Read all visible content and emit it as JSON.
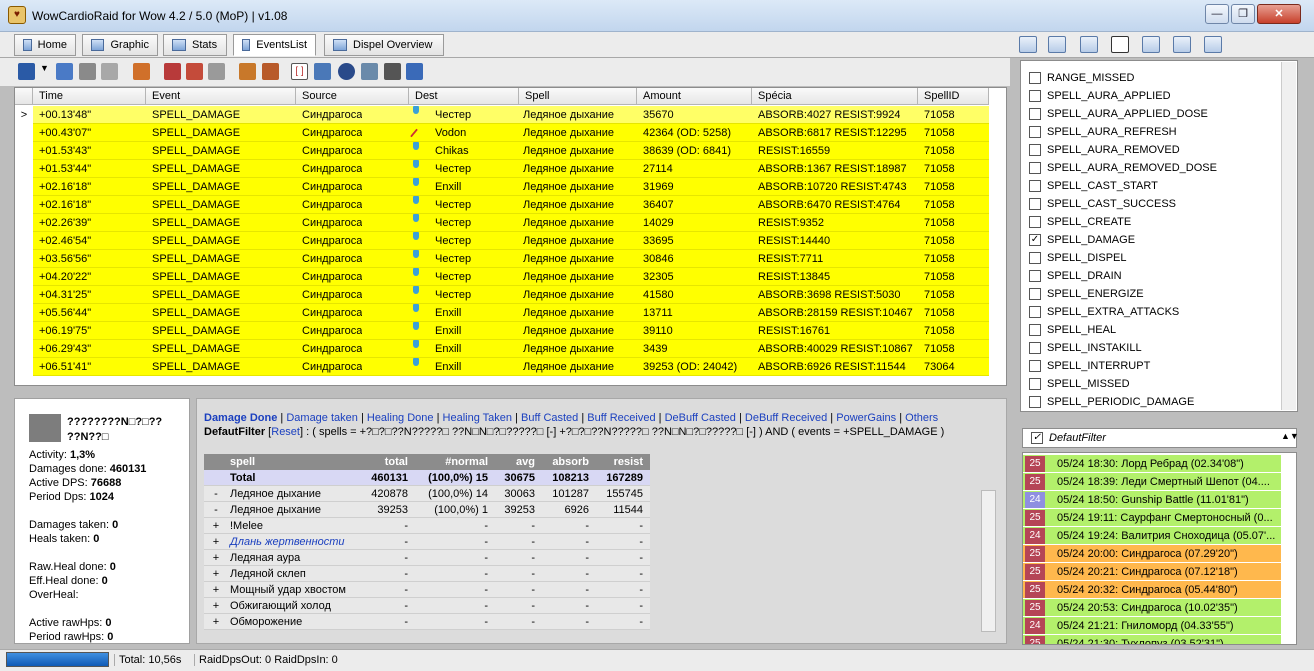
{
  "window": {
    "title": "WowCardioRaid for Wow 4.2 / 5.0 (MoP) | v1.08",
    "min": "—",
    "max": "❐",
    "close": "✕"
  },
  "tabs": [
    {
      "label": "Home"
    },
    {
      "label": "Graphic"
    },
    {
      "label": "Stats"
    },
    {
      "label": "EventsList"
    },
    {
      "label": "Dispel Overview"
    }
  ],
  "grid": {
    "columns": [
      "Time",
      "Event",
      "Source",
      "Dest",
      "Spell",
      "Amount",
      "Spécia",
      "SpellID"
    ],
    "rows": [
      {
        "mark": ">",
        "time": "+00.13'48\"",
        "event": "SPELL_DAMAGE",
        "source": "Синдрагоса",
        "dest": "Честер",
        "spell": "Ледяное дыхание",
        "amount": "35670",
        "special": "ABSORB:4027 RESIST:9924",
        "id": "71058",
        "icon": "shield"
      },
      {
        "mark": "",
        "time": "+00.43'07\"",
        "event": "SPELL_DAMAGE",
        "source": "Синдрагоса",
        "dest": "Vodon",
        "spell": "Ледяное дыхание",
        "amount": "42364 (OD: 5258)",
        "special": "ABSORB:6817 RESIST:12295",
        "id": "71058",
        "icon": "sword"
      },
      {
        "mark": "",
        "time": "+01.53'43\"",
        "event": "SPELL_DAMAGE",
        "source": "Синдрагоса",
        "dest": "Chikas",
        "spell": "Ледяное дыхание",
        "amount": "38639 (OD: 6841)",
        "special": "RESIST:16559",
        "id": "71058",
        "icon": "shield"
      },
      {
        "mark": "",
        "time": "+01.53'44\"",
        "event": "SPELL_DAMAGE",
        "source": "Синдрагоса",
        "dest": "Честер",
        "spell": "Ледяное дыхание",
        "amount": "27114",
        "special": "ABSORB:1367 RESIST:18987",
        "id": "71058",
        "icon": "shield"
      },
      {
        "mark": "",
        "time": "+02.16'18\"",
        "event": "SPELL_DAMAGE",
        "source": "Синдрагоса",
        "dest": "Enxill",
        "spell": "Ледяное дыхание",
        "amount": "31969",
        "special": "ABSORB:10720 RESIST:4743",
        "id": "71058",
        "icon": "shield"
      },
      {
        "mark": "",
        "time": "+02.16'18\"",
        "event": "SPELL_DAMAGE",
        "source": "Синдрагоса",
        "dest": "Честер",
        "spell": "Ледяное дыхание",
        "amount": "36407",
        "special": "ABSORB:6470 RESIST:4764",
        "id": "71058",
        "icon": "shield"
      },
      {
        "mark": "",
        "time": "+02.26'39\"",
        "event": "SPELL_DAMAGE",
        "source": "Синдрагоса",
        "dest": "Честер",
        "spell": "Ледяное дыхание",
        "amount": "14029",
        "special": "RESIST:9352",
        "id": "71058",
        "icon": "shield"
      },
      {
        "mark": "",
        "time": "+02.46'54\"",
        "event": "SPELL_DAMAGE",
        "source": "Синдрагоса",
        "dest": "Честер",
        "spell": "Ледяное дыхание",
        "amount": "33695",
        "special": "RESIST:14440",
        "id": "71058",
        "icon": "shield"
      },
      {
        "mark": "",
        "time": "+03.56'56\"",
        "event": "SPELL_DAMAGE",
        "source": "Синдрагоса",
        "dest": "Честер",
        "spell": "Ледяное дыхание",
        "amount": "30846",
        "special": "RESIST:7711",
        "id": "71058",
        "icon": "shield"
      },
      {
        "mark": "",
        "time": "+04.20'22\"",
        "event": "SPELL_DAMAGE",
        "source": "Синдрагоса",
        "dest": "Честер",
        "spell": "Ледяное дыхание",
        "amount": "32305",
        "special": "RESIST:13845",
        "id": "71058",
        "icon": "shield"
      },
      {
        "mark": "",
        "time": "+04.31'25\"",
        "event": "SPELL_DAMAGE",
        "source": "Синдрагоса",
        "dest": "Честер",
        "spell": "Ледяное дыхание",
        "amount": "41580",
        "special": "ABSORB:3698 RESIST:5030",
        "id": "71058",
        "icon": "shield"
      },
      {
        "mark": "",
        "time": "+05.56'44\"",
        "event": "SPELL_DAMAGE",
        "source": "Синдрагоса",
        "dest": "Enxill",
        "spell": "Ледяное дыхание",
        "amount": "13711",
        "special": "ABSORB:28159 RESIST:10467",
        "id": "71058",
        "icon": "shield"
      },
      {
        "mark": "",
        "time": "+06.19'75\"",
        "event": "SPELL_DAMAGE",
        "source": "Синдрагоса",
        "dest": "Enxill",
        "spell": "Ледяное дыхание",
        "amount": "39110",
        "special": "RESIST:16761",
        "id": "71058",
        "icon": "shield"
      },
      {
        "mark": "",
        "time": "+06.29'43\"",
        "event": "SPELL_DAMAGE",
        "source": "Синдрагоса",
        "dest": "Enxill",
        "spell": "Ледяное дыхание",
        "amount": "3439",
        "special": "ABSORB:40029 RESIST:10867",
        "id": "71058",
        "icon": "shield"
      },
      {
        "mark": "",
        "time": "+06.51'41\"",
        "event": "SPELL_DAMAGE",
        "source": "Синдрагоса",
        "dest": "Enxill",
        "spell": "Ледяное дыхание",
        "amount": "39253 (OD: 24042)",
        "special": "ABSORB:6926 RESIST:11544",
        "id": "73064",
        "icon": "shield"
      }
    ]
  },
  "player": {
    "name1": "????????N□?□??",
    "name2": "??N??□",
    "stats": [
      {
        "label": "Activity: ",
        "value": "1,3%"
      },
      {
        "label": "Damages done: ",
        "value": "460131"
      },
      {
        "label": "Active DPS: ",
        "value": "76688"
      },
      {
        "label": "Period Dps: ",
        "value": "1024"
      },
      {
        "label": "Damages taken: ",
        "value": "0"
      },
      {
        "label": "Heals taken: ",
        "value": "0"
      },
      {
        "label": "Raw.Heal done: ",
        "value": "0"
      },
      {
        "label": "Eff.Heal done: ",
        "value": "0"
      },
      {
        "label": "OverHeal:",
        "value": ""
      },
      {
        "label": "Active rawHps: ",
        "value": "0"
      },
      {
        "label": "Period rawHps: ",
        "value": "0"
      }
    ]
  },
  "filters": {
    "links": [
      "Damage Done",
      "Damage taken",
      "Healing Done",
      "Healing Taken",
      "Buff Casted",
      "Buff Received",
      "DeBuff Casted",
      "DeBuff Received",
      "PowerGains",
      "Others"
    ],
    "line_label": "DefautFilter",
    "reset": "Reset",
    "expr": ": ( spells = +?□?□??N?????□ ??N□N□?□?????□ [-] +?□?□??N?????□ ??N□N□?□?????□ [-] ) AND ( events = +SPELL_DAMAGE )"
  },
  "spells": {
    "columns": [
      "spell",
      "total",
      "#normal",
      "avg",
      "absorb",
      "resist"
    ],
    "rows": [
      {
        "sign": "",
        "name": "Total",
        "total": "460131",
        "normal": "(100,0%)  15",
        "avg": "30675",
        "absorb": "108213",
        "resist": "167289",
        "style": "total"
      },
      {
        "sign": "-",
        "name": "Ледяное дыхание",
        "total": "420878",
        "normal": "(100,0%)  14",
        "avg": "30063",
        "absorb": "101287",
        "resist": "155745",
        "style": ""
      },
      {
        "sign": "-",
        "name": "Ледяное дыхание",
        "total": "39253",
        "normal": "(100,0%)  1",
        "avg": "39253",
        "absorb": "6926",
        "resist": "11544",
        "style": ""
      },
      {
        "sign": "+",
        "name": "!Melee",
        "total": "-",
        "normal": "-",
        "avg": "-",
        "absorb": "-",
        "resist": "-",
        "style": ""
      },
      {
        "sign": "+",
        "name": "Длань жертвенности",
        "total": "-",
        "normal": "-",
        "avg": "-",
        "absorb": "-",
        "resist": "-",
        "style": "link"
      },
      {
        "sign": "+",
        "name": "Ледяная аура",
        "total": "-",
        "normal": "-",
        "avg": "-",
        "absorb": "-",
        "resist": "-",
        "style": ""
      },
      {
        "sign": "+",
        "name": "Ледяной склеп",
        "total": "-",
        "normal": "-",
        "avg": "-",
        "absorb": "-",
        "resist": "-",
        "style": ""
      },
      {
        "sign": "+",
        "name": "Мощный удар хвостом",
        "total": "-",
        "normal": "-",
        "avg": "-",
        "absorb": "-",
        "resist": "-",
        "style": ""
      },
      {
        "sign": "+",
        "name": "Обжигающий холод",
        "total": "-",
        "normal": "-",
        "avg": "-",
        "absorb": "-",
        "resist": "-",
        "style": ""
      },
      {
        "sign": "+",
        "name": "Обморожение",
        "total": "-",
        "normal": "-",
        "avg": "-",
        "absorb": "-",
        "resist": "-",
        "style": ""
      }
    ]
  },
  "events": [
    {
      "label": "RANGE_MISSED",
      "checked": false
    },
    {
      "label": "SPELL_AURA_APPLIED",
      "checked": false
    },
    {
      "label": "SPELL_AURA_APPLIED_DOSE",
      "checked": false
    },
    {
      "label": "SPELL_AURA_REFRESH",
      "checked": false
    },
    {
      "label": "SPELL_AURA_REMOVED",
      "checked": false
    },
    {
      "label": "SPELL_AURA_REMOVED_DOSE",
      "checked": false
    },
    {
      "label": "SPELL_CAST_START",
      "checked": false
    },
    {
      "label": "SPELL_CAST_SUCCESS",
      "checked": false
    },
    {
      "label": "SPELL_CREATE",
      "checked": false
    },
    {
      "label": "SPELL_DAMAGE",
      "checked": true
    },
    {
      "label": "SPELL_DISPEL",
      "checked": false
    },
    {
      "label": "SPELL_DRAIN",
      "checked": false
    },
    {
      "label": "SPELL_ENERGIZE",
      "checked": false
    },
    {
      "label": "SPELL_EXTRA_ATTACKS",
      "checked": false
    },
    {
      "label": "SPELL_HEAL",
      "checked": false
    },
    {
      "label": "SPELL_INSTAKILL",
      "checked": false
    },
    {
      "label": "SPELL_INTERRUPT",
      "checked": false
    },
    {
      "label": "SPELL_MISSED",
      "checked": false
    },
    {
      "label": "SPELL_PERIODIC_DAMAGE",
      "checked": false
    }
  ],
  "filter_combo": {
    "label": "DefautFilter",
    "checked": true
  },
  "fights": [
    {
      "n": "25",
      "text": "05/24  18:30: Лорд Ребрад (02.34'08\")",
      "color": "#b3f06b",
      "ncolor": "#b54556"
    },
    {
      "n": "25",
      "text": "05/24  18:39: Леди Смертный Шепот (04....",
      "color": "#b3f06b",
      "ncolor": "#b54556"
    },
    {
      "n": "24",
      "text": "05/24  18:50: Gunship Battle (11.01'81\")",
      "color": "#b3f06b",
      "ncolor": "#8f8fe0"
    },
    {
      "n": "25",
      "text": "05/24  19:11: Саурфанг Смертоносный (0...",
      "color": "#b3f06b",
      "ncolor": "#b54556"
    },
    {
      "n": "24",
      "text": "05/24  19:24: Валитрия Сноходица (05.07'...",
      "color": "#b3f06b",
      "ncolor": "#b54556"
    },
    {
      "n": "25",
      "text": "05/24  20:00: Синдрагоса (07.29'20\")",
      "color": "#ffb84d",
      "ncolor": "#b54556"
    },
    {
      "n": "25",
      "text": "05/24  20:21: Синдрагоса (07.12'18\")",
      "color": "#ffb84d",
      "ncolor": "#b54556"
    },
    {
      "n": "25",
      "text": "05/24  20:32: Синдрагоса (05.44'80\")",
      "color": "#ffb84d",
      "ncolor": "#b54556"
    },
    {
      "n": "25",
      "text": "05/24  20:53: Синдрагоса (10.02'35\")",
      "color": "#b3f06b",
      "ncolor": "#b54556"
    },
    {
      "n": "24",
      "text": "05/24  21:21: Гниломорд (04.33'55\")",
      "color": "#b3f06b",
      "ncolor": "#b54556"
    },
    {
      "n": "25",
      "text": "05/24  21:30: Тухлопуз (03.52'31\")",
      "color": "#b3f06b",
      "ncolor": "#b54556"
    }
  ],
  "status": {
    "total": "Total: 10,56s",
    "raid": "RaidDpsOut: 0 RaidDpsIn: 0"
  }
}
